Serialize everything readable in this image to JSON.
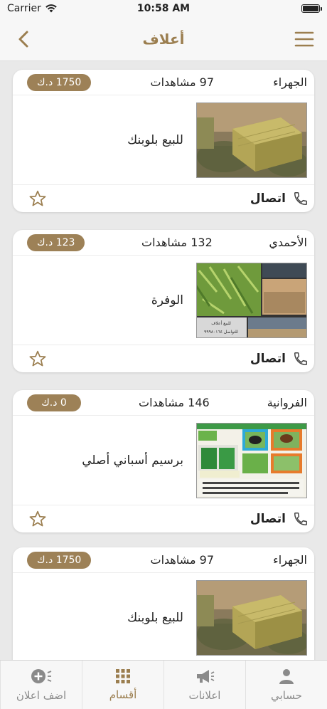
{
  "status_bar": {
    "carrier": "Carrier",
    "time": "10:58 AM",
    "battery_level": 1.0
  },
  "nav": {
    "title": "أعلاف",
    "back_icon": "chevron-left-icon",
    "menu_icon": "hamburger-menu-icon"
  },
  "colors": {
    "accent": "#9b7e4f",
    "badge": "#9d8157",
    "background": "#e9e9e9"
  },
  "listings": [
    {
      "location": "الجهراء",
      "views": "97 مشاهدات",
      "price": "1750 د.ك",
      "title": "للبيع بلوبنك",
      "contact": "اتصال",
      "image": "hay-bale-photo"
    },
    {
      "location": "الأحمدي",
      "views": "132 مشاهدات",
      "price": "123 د.ك",
      "title": "الوفرة",
      "contact": "اتصال",
      "image": "farm-collage-photo",
      "image_caption_1": "للبيع أعلاف",
      "image_caption_2": "للتواصل ٩٩٩٨٠١٦٤"
    },
    {
      "location": "الفروانية",
      "views": "146 مشاهدات",
      "price": "0 د.ك",
      "title": "برسيم أسباني أصلي",
      "contact": "اتصال",
      "image": "alfalfa-ad-photo"
    },
    {
      "location": "الجهراء",
      "views": "97 مشاهدات",
      "price": "1750 د.ك",
      "title": "للبيع بلوبنك",
      "contact": "اتصال",
      "image": "hay-bale-photo"
    }
  ],
  "tabs": [
    {
      "label": "حسابي",
      "icon": "user-icon",
      "active": false
    },
    {
      "label": "اعلانات",
      "icon": "megaphone-icon",
      "active": false
    },
    {
      "label": "أقسام",
      "icon": "grid-icon",
      "active": true
    },
    {
      "label": "اضف اعلان",
      "icon": "add-post-icon",
      "active": false
    }
  ]
}
